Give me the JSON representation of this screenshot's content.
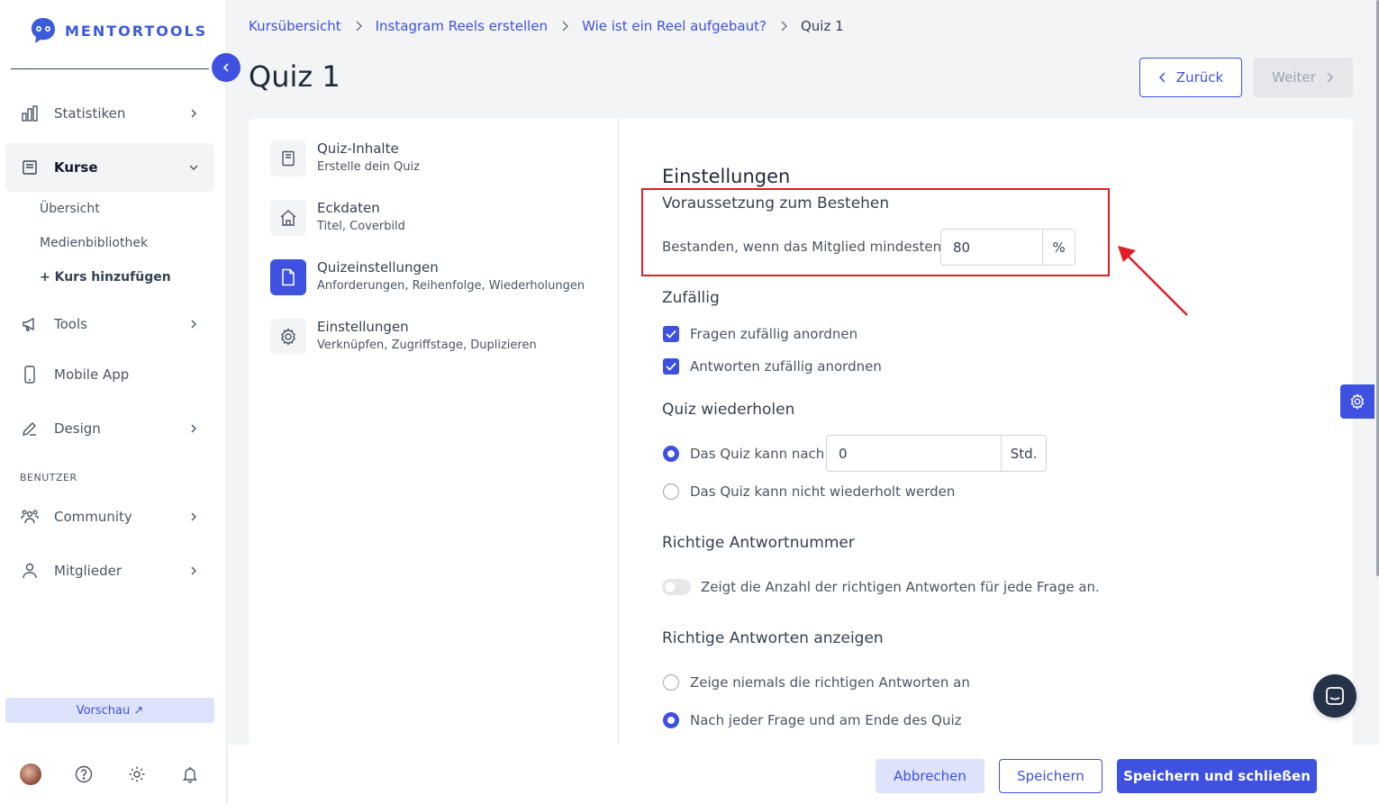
{
  "brand": {
    "name": "MENTORTOOLS",
    "accent": "#3f51e0"
  },
  "sidebar": {
    "items": [
      {
        "label": "Statistiken",
        "icon": "bar-chart-icon"
      },
      {
        "label": "Kurse",
        "icon": "book-icon"
      },
      {
        "label": "Tools",
        "icon": "megaphone-icon"
      },
      {
        "label": "Mobile App",
        "icon": "phone-icon"
      },
      {
        "label": "Design",
        "icon": "pencil-icon"
      },
      {
        "label": "Community",
        "icon": "people-icon"
      },
      {
        "label": "Mitglieder",
        "icon": "user-icon"
      }
    ],
    "kurse_sub": [
      "Übersicht",
      "Medienbibliothek",
      "+ Kurs hinzufügen"
    ],
    "section_label": "BENUTZER",
    "preview": "Vorschau ↗"
  },
  "breadcrumb": [
    "Kursübersicht",
    "Instagram Reels erstellen",
    "Wie ist ein Reel aufgebaut?",
    "Quiz 1"
  ],
  "page": {
    "title": "Quiz 1",
    "back": "Zurück",
    "next": "Weiter"
  },
  "steps": [
    {
      "title": "Quiz-Inhalte",
      "sub": "Erstelle dein Quiz"
    },
    {
      "title": "Eckdaten",
      "sub": "Titel, Coverbild"
    },
    {
      "title": "Quizeinstellungen",
      "sub": "Anforderungen, Reihenfolge, Wiederholungen"
    },
    {
      "title": "Einstellungen",
      "sub": "Verknüpfen, Zugriffstage, Duplizieren"
    }
  ],
  "settings": {
    "heading": "Einstellungen",
    "pass": {
      "title": "Voraussetzung zum Bestehen",
      "label": "Bestanden, wenn das Mitglied mindestens",
      "value": "80",
      "unit": "%"
    },
    "random": {
      "title": "Zufällig",
      "q": "Fragen zufällig anordnen",
      "a": "Antworten zufällig anordnen"
    },
    "repeat": {
      "title": "Quiz wiederholen",
      "opt1": "Das Quiz kann nach",
      "value": "0",
      "unit": "Std.",
      "opt2": "Das Quiz kann nicht wiederholt werden"
    },
    "correct_num": {
      "title": "Richtige Antwortnummer",
      "label": "Zeigt die Anzahl der richtigen Antworten für jede Frage an."
    },
    "show_correct": {
      "title": "Richtige Antworten anzeigen",
      "opt1": "Zeige niemals die richtigen Antworten an",
      "opt2": "Nach jeder Frage und am Ende des Quiz"
    }
  },
  "footer": {
    "cancel": "Abbrechen",
    "save": "Speichern",
    "save_close": "Speichern und schließen"
  }
}
